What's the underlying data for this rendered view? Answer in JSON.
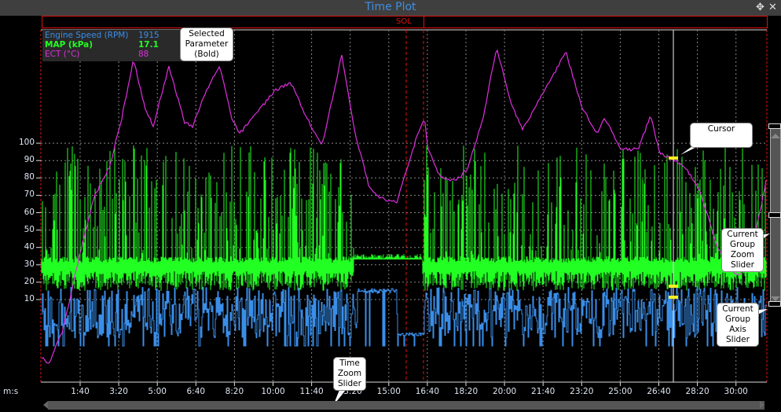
{
  "window": {
    "title": "Time Plot",
    "move_icon": "move-icon",
    "close_icon": "close-icon"
  },
  "sol_bar": {
    "label": "SOL"
  },
  "legend": {
    "items": [
      {
        "name": "Engine Speed (RPM)",
        "value": "1915",
        "color": "#3a8ee8",
        "bold": false
      },
      {
        "name": "MAP (kPa)",
        "value": "17.1",
        "color": "#22ff22",
        "bold": true
      },
      {
        "name": "ECT (°C)",
        "value": "88",
        "color": "#e02ee0",
        "bold": false
      }
    ]
  },
  "callouts": {
    "selected": "Selected Parameter (Bold)",
    "cursor": "Cursor",
    "zoom_slider": "Current Group Zoom Slider",
    "axis_slider": "Current Group Axis Slider",
    "time_zoom": "Time Zoom Slider"
  },
  "axis": {
    "x_units": "m:s",
    "y_ticks": [
      "100",
      "90",
      "80",
      "70",
      "60",
      "50",
      "40",
      "30",
      "20",
      "10"
    ],
    "x_ticks": [
      "1:40",
      "3:20",
      "5:00",
      "6:40",
      "8:20",
      "10:00",
      "11:40",
      "13:20",
      "15:00",
      "16:40",
      "18:20",
      "20:00",
      "21:40",
      "23:20",
      "25:00",
      "26:40",
      "28:20",
      "30:00"
    ]
  },
  "cursor": {
    "time": "27:20",
    "color": "#ffee22"
  },
  "colors": {
    "rpm": "#3a8ee8",
    "map": "#22ff22",
    "ect": "#e02ee0",
    "grid": "#888888",
    "sol": "#e01010"
  }
}
